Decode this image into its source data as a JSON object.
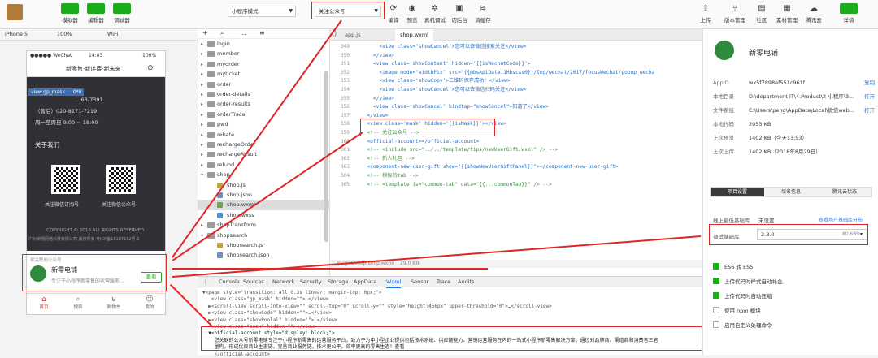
{
  "toolbar": {
    "simulator": "模拟器",
    "editor": "编辑器",
    "debugger": "调试器",
    "mode_select": "小程序模式",
    "page_select": "关注公众号",
    "compile": "编译",
    "preview": "预览",
    "realdebug": "真机调试",
    "backstage": "切后台",
    "clearcache": "清缓存",
    "upload": "上传",
    "version": "版本管理",
    "community": "社区",
    "material": "素材管理",
    "tencentcloud": "腾讯云",
    "detail": "详情"
  },
  "simbar": {
    "device": "iPhone 5",
    "zoom": "100%",
    "network": "WiFi"
  },
  "phone": {
    "status_left": "●●●●● WeChat",
    "status_time": "14:03",
    "status_right": "100%",
    "nav_title": "新零售·新连接·新未来",
    "tooltip_name": "view.gp_mask",
    "tooltip_size": "0*0",
    "phone1": "…63-7391",
    "phone2": "（售后）020-8171-7219",
    "hours": "周一至周日 9:00 ~ 18:00",
    "about": "关于我们",
    "qr1_label": "关注微信订阅号",
    "qr2_label": "关注微信公众号",
    "copyright": "COPYRIGHT © 2018 ALL RIGHTS RESERVED",
    "company": "广州荣翔网络科技有限公司 版权所有 粤ICP备18107152号-1",
    "official_header": "相关联的公众号",
    "official_name": "新零电铺",
    "official_desc": "专注于小程序新零售的运营服务...",
    "follow_button": "查看",
    "tabbar": [
      "首页",
      "搜索",
      "购物车",
      "我的"
    ]
  },
  "tree": {
    "items": [
      {
        "label": "login",
        "type": "folder"
      },
      {
        "label": "member",
        "type": "folder"
      },
      {
        "label": "myorder",
        "type": "folder"
      },
      {
        "label": "myticket",
        "type": "folder"
      },
      {
        "label": "order",
        "type": "folder"
      },
      {
        "label": "order-details",
        "type": "folder"
      },
      {
        "label": "order-results",
        "type": "folder"
      },
      {
        "label": "orderTrace",
        "type": "folder"
      },
      {
        "label": "pwd",
        "type": "folder"
      },
      {
        "label": "rebate",
        "type": "folder"
      },
      {
        "label": "rechargeOrder",
        "type": "folder"
      },
      {
        "label": "rechargeResult",
        "type": "folder"
      },
      {
        "label": "refund",
        "type": "folder"
      },
      {
        "label": "shop",
        "type": "folder-open"
      },
      {
        "label": "shop.js",
        "type": "js"
      },
      {
        "label": "shop.json",
        "type": "json"
      },
      {
        "label": "shop.wxml",
        "type": "wxml"
      },
      {
        "label": "shop.wxss",
        "type": "wxss"
      },
      {
        "label": "shopTransform",
        "type": "folder"
      },
      {
        "label": "shopsearch",
        "type": "folder-open"
      },
      {
        "label": "shopsearch.js",
        "type": "js"
      },
      {
        "label": "shopsearch.json",
        "type": "json"
      }
    ]
  },
  "editor": {
    "tabs": [
      "app.js",
      "shop.wxml"
    ],
    "status_path": "/pages/shop/shop.wxml",
    "status_size": "29.0 KB",
    "lines": [
      {
        "n": "349",
        "t": "      <view class=\"showCancel\">您可以去微信搜索关注</view>"
      },
      {
        "n": "350",
        "t": "    </view>"
      },
      {
        "n": "351",
        "t": "    <view class='showContent' hidden='{{isWechatCode}}'>"
      },
      {
        "n": "352",
        "t": "      <image mode=\"widthFix\" src=\"{{mbsApiData.1Mbscss0}}/Img/wechat/2017/focusWechat/popup_wecha"
      },
      {
        "n": "353",
        "t": "      <view class='showCopy'>二维码保存成功！</view>"
      },
      {
        "n": "354",
        "t": "      <view class='showCancel'>您可以去微信扫码关注</view>"
      },
      {
        "n": "355",
        "t": "    </view>"
      },
      {
        "n": "356",
        "t": "    <view class='showCancel' bindtap=\"showCancel\">知道了</view>"
      },
      {
        "n": "357",
        "t": "  </view>"
      },
      {
        "n": "358",
        "t": "  <view class='mask' hidden='{{isMask}}'></view>"
      },
      {
        "n": "359",
        "t": "  <!-- 关注公众号 -->"
      },
      {
        "n": "360",
        "t": "  <official-account></official-account>"
      },
      {
        "n": "361",
        "t": "  <!-- <include src=\"../../template/tips/newUserGift.wxml\" /> -->"
      },
      {
        "n": "362",
        "t": "  <!-- 新人礼包 -->"
      },
      {
        "n": "363",
        "t": "  <component-new-user-gift show=\"{{showNewUserGiftPanel}}\"></component-new-user-gift>"
      },
      {
        "n": "364",
        "t": "  <!-- 模拟的tab -->"
      },
      {
        "n": "365",
        "t": "  <!-- <template is=\"common-tab\" data=\"{{...commonTab}}\" /> -->"
      }
    ]
  },
  "debug": {
    "tabs": [
      "Console",
      "Sources",
      "Network",
      "Security",
      "Storage",
      "AppData",
      "Wxml",
      "Sensor",
      "Trace",
      "Audits"
    ],
    "lines": [
      "▼<page style=\"transition: all 0.3s linear; margin-top: 0px;\">",
      "   <view class=\"gp_mask\" hidden=\"\">…</view>",
      "  ▶<scroll-view scroll-into-view=\"\" scroll-top=\"0\" scroll-y=\"\" style=\"height:456px\" upper-threshold=\"0\">…</scroll-view>",
      "  ▶<view class=\"showCode\" hidden=\"\">…</view>",
      "  ▶<view class=\"showPoolal\" hidden=\"\">…</view>",
      "   <view class=\"mask\" hidden=\"\"></view>",
      "  ▼<official-account style=\"display: block;\">",
      "    您关联的公众号新零电铺专注于小程序新零售的运营服务平台，致力于为中小型企业提供包括技术系统、供应链能力、营销运营服务在内的一站式小程序新零售解决方案；通过对品牌商、渠道商和消费者三者",
      "    量构，形成优良商业生态链，完善商业服务链，技术更公平，效率更高的零售生态！查看",
      "    </official-account>"
    ]
  },
  "panel": {
    "app_name": "新零电铺",
    "rows": [
      {
        "k": "AppID",
        "v": "wx5f7898ef551c961f",
        "a": "复制"
      },
      {
        "k": "本地目录",
        "v": "D:\\department IT\\4.Product\\2 小程序\\3...",
        "a": "打开"
      },
      {
        "k": "文件系统",
        "v": "C:\\Users\\peng\\AppData\\Local\\微信web...",
        "a": "打开"
      },
      {
        "k": "本地代码",
        "v": "2053 KB",
        "a": ""
      },
      {
        "k": "上次预览",
        "v": "1402 KB（今天13:53）",
        "a": ""
      },
      {
        "k": "上次上传",
        "v": "1402 KB（2018年8月29日）",
        "a": ""
      }
    ],
    "tabs": [
      "项目设置",
      "域名信息",
      "腾讯云状态"
    ],
    "lib_label": "线上最低基础库",
    "lib_value": "未设置",
    "lib_link": "查看用户基础库分布",
    "debug_lib_label": "调试基础库",
    "debug_lib_value": "2.3.0",
    "debug_lib_percent": "80.68%",
    "checks": [
      {
        "label": "ES6 转 ES5",
        "on": true
      },
      {
        "label": "上传代码时样式自动补全",
        "on": true
      },
      {
        "label": "上传代码时自动压缩",
        "on": true
      },
      {
        "label": "使用 npm 模块",
        "on": false
      },
      {
        "label": "启用自定义处理命令",
        "on": false
      }
    ]
  },
  "colors": {
    "accent": "#1aad19",
    "highlight": "#e02525",
    "link": "#3b7bd3"
  }
}
